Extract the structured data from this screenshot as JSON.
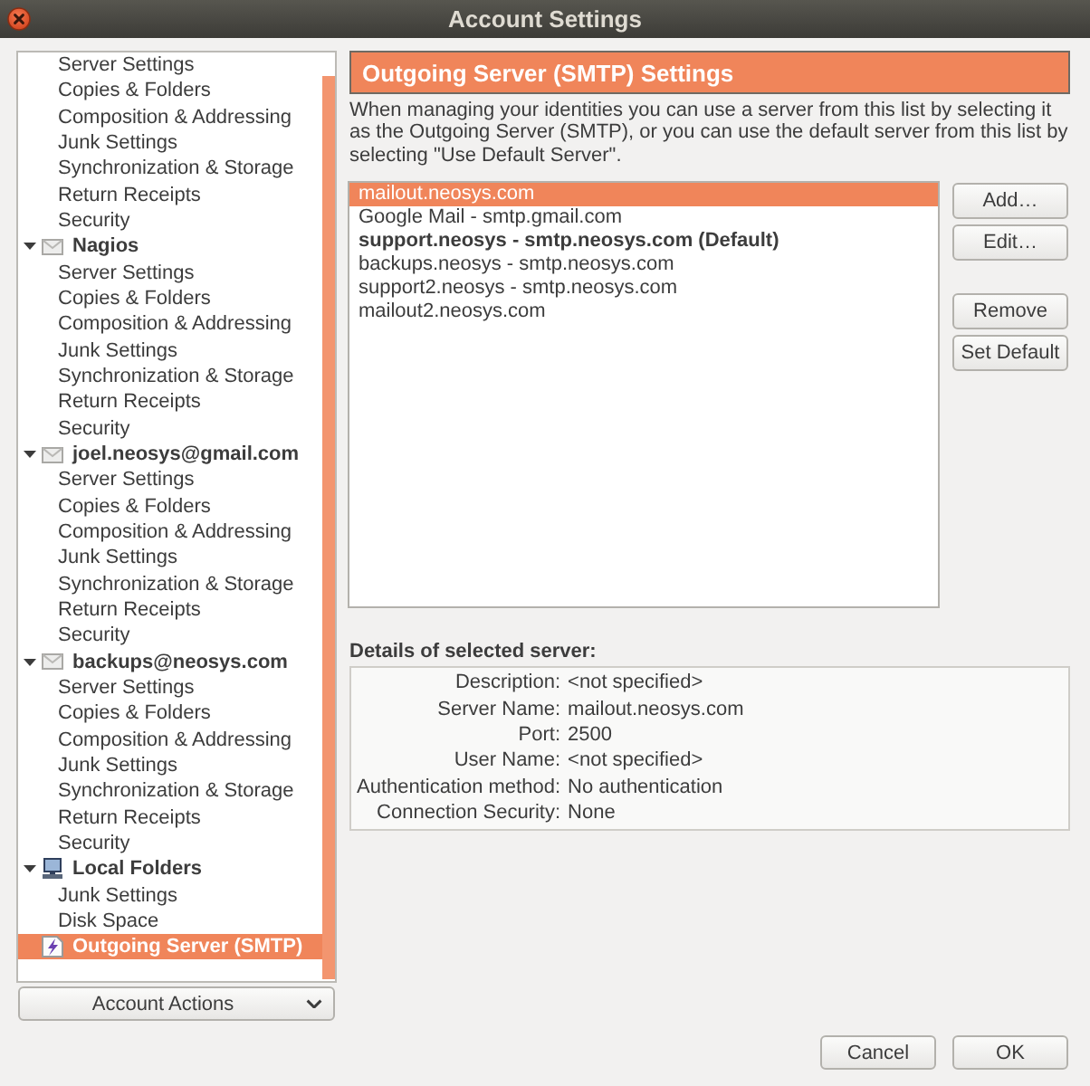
{
  "window": {
    "title": "Account Settings"
  },
  "tree": {
    "items": [
      {
        "children": [
          {
            "label": "Server Settings",
            "selected": false
          },
          {
            "label": "Copies & Folders",
            "selected": false
          },
          {
            "label": "Composition & Addressing",
            "selected": false
          },
          {
            "label": "Junk Settings",
            "selected": false
          },
          {
            "label": "Synchronization & Storage",
            "selected": false
          },
          {
            "label": "Return Receipts",
            "selected": false
          },
          {
            "label": "Security",
            "selected": false
          }
        ]
      },
      {
        "kind": "account",
        "label": "Nagios",
        "expanded": true,
        "selected": false,
        "children": [
          {
            "label": "Server Settings",
            "selected": false
          },
          {
            "label": "Copies & Folders",
            "selected": false
          },
          {
            "label": "Composition & Addressing",
            "selected": false
          },
          {
            "label": "Junk Settings",
            "selected": false
          },
          {
            "label": "Synchronization & Storage",
            "selected": false
          },
          {
            "label": "Return Receipts",
            "selected": false
          },
          {
            "label": "Security",
            "selected": false
          }
        ]
      },
      {
        "kind": "account",
        "label": "joel.neosys@gmail.com",
        "expanded": true,
        "selected": false,
        "children": [
          {
            "label": "Server Settings",
            "selected": false
          },
          {
            "label": "Copies & Folders",
            "selected": false
          },
          {
            "label": "Composition & Addressing",
            "selected": false
          },
          {
            "label": "Junk Settings",
            "selected": false
          },
          {
            "label": "Synchronization & Storage",
            "selected": false
          },
          {
            "label": "Return Receipts",
            "selected": false
          },
          {
            "label": "Security",
            "selected": false
          }
        ]
      },
      {
        "kind": "account",
        "label": "backups@neosys.com",
        "expanded": true,
        "selected": false,
        "children": [
          {
            "label": "Server Settings",
            "selected": false
          },
          {
            "label": "Copies & Folders",
            "selected": false
          },
          {
            "label": "Composition & Addressing",
            "selected": false
          },
          {
            "label": "Junk Settings",
            "selected": false
          },
          {
            "label": "Synchronization & Storage",
            "selected": false
          },
          {
            "label": "Return Receipts",
            "selected": false
          },
          {
            "label": "Security",
            "selected": false
          }
        ]
      },
      {
        "kind": "local",
        "label": "Local Folders",
        "expanded": true,
        "selected": false,
        "children": [
          {
            "label": "Junk Settings",
            "selected": false
          },
          {
            "label": "Disk Space",
            "selected": false
          }
        ]
      },
      {
        "kind": "outgoing",
        "label": "Outgoing Server (SMTP)",
        "selected": true
      }
    ]
  },
  "account_actions": {
    "label": "Account Actions"
  },
  "panel": {
    "title": "Outgoing Server (SMTP) Settings",
    "description": "When managing your identities you can use a server from this list by selecting it as the Outgoing Server (SMTP), or you can use the default server from this list by selecting \"Use Default Server\".",
    "servers": [
      {
        "label": "mailout.neosys.com",
        "selected": true,
        "default": false
      },
      {
        "label": "Google Mail - smtp.gmail.com",
        "selected": false,
        "default": false
      },
      {
        "label": "support.neosys - smtp.neosys.com (Default)",
        "selected": false,
        "default": true
      },
      {
        "label": "backups.neosys - smtp.neosys.com",
        "selected": false,
        "default": false
      },
      {
        "label": "support2.neosys - smtp.neosys.com",
        "selected": false,
        "default": false
      },
      {
        "label": "mailout2.neosys.com",
        "selected": false,
        "default": false
      }
    ],
    "button_groups": [
      {
        "add": "Add…",
        "edit": "Edit…"
      },
      {
        "remove": "Remove",
        "set_default": "Set Default"
      }
    ],
    "details_title": "Details of selected server:",
    "details": [
      {
        "label": "Description:",
        "value": "<not specified>"
      },
      {
        "label": "Server Name:",
        "value": "mailout.neosys.com"
      },
      {
        "label": "Port:",
        "value": "2500"
      },
      {
        "label": "User Name:",
        "value": "<not specified>"
      },
      {
        "label": "Authentication method:",
        "value": "No authentication"
      },
      {
        "label": "Connection Security:",
        "value": "None"
      }
    ]
  },
  "dialog_buttons": {
    "cancel": "Cancel",
    "ok": "OK"
  }
}
